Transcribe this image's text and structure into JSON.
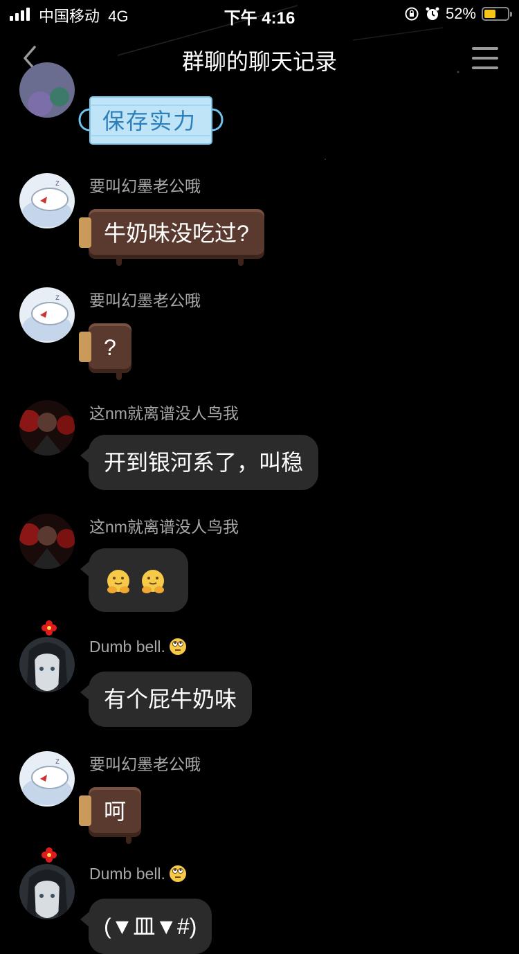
{
  "status_bar": {
    "carrier": "中国移动",
    "network": "4G",
    "time": "下午 4:16",
    "battery_percent": "52%",
    "battery_level": 0.52,
    "icons": [
      "signal-icon",
      "rotation-lock-icon",
      "alarm-icon",
      "battery-icon"
    ]
  },
  "nav": {
    "title": "群聊的聊天记录",
    "back_icon": "chevron-left-icon",
    "menu_icon": "hamburger-menu-icon"
  },
  "messages": [
    {
      "sender": "",
      "text": "保存实力",
      "style": "sticker-mask"
    },
    {
      "sender": "要叫幻墨老公哦",
      "text": "牛奶味没吃过?",
      "style": "chocolate"
    },
    {
      "sender": "要叫幻墨老公哦",
      "text": "?",
      "style": "chocolate"
    },
    {
      "sender": "这nm就离谱没人鸟我",
      "text": "开到银河系了，叫稳",
      "style": "dark"
    },
    {
      "sender": "这nm就离谱没人鸟我",
      "text": "",
      "style": "dark",
      "emojis": [
        "hug-face-emoji",
        "hug-face-emoji"
      ]
    },
    {
      "sender": "Dumb bell.",
      "text": "有个屁牛奶味",
      "style": "dark",
      "sender_emoji": "eye-roll-emoji"
    },
    {
      "sender": "要叫幻墨老公哦",
      "text": "呵",
      "style": "chocolate"
    },
    {
      "sender": "Dumb bell.",
      "text": "(▼皿▼#)",
      "style": "dark",
      "sender_emoji": "eye-roll-emoji"
    }
  ],
  "colors": {
    "background": "#000000",
    "bubble_dark": "#2b2b2b",
    "chocolate": "#5a3a2e",
    "sender_text": "#a8a8a8",
    "battery_fill": "#f5c518"
  }
}
